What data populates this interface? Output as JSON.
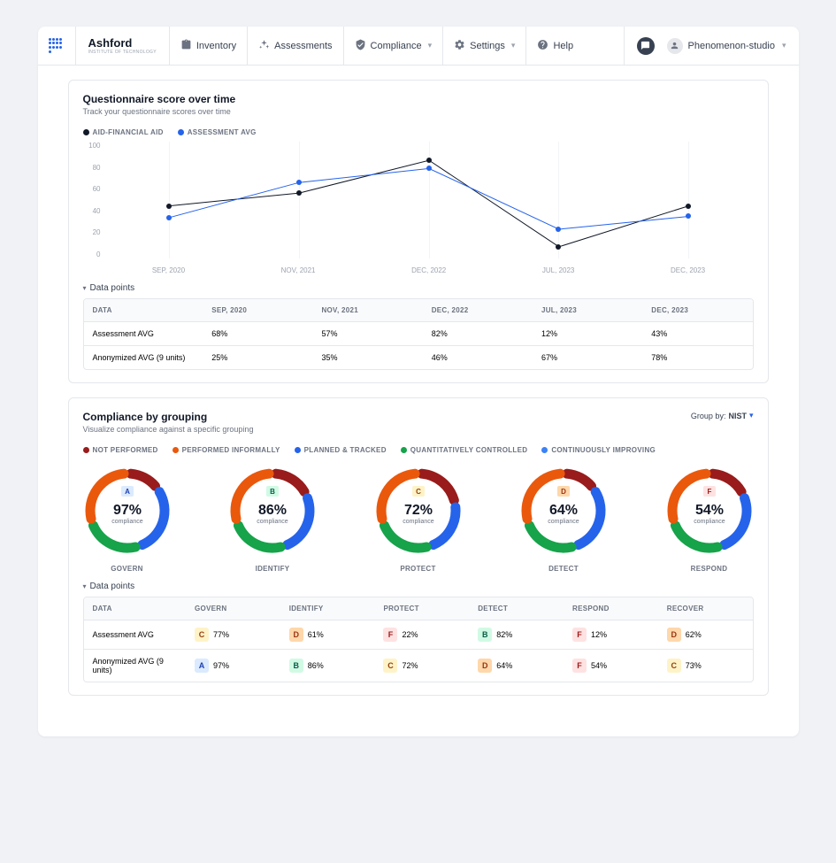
{
  "brand": "Ashford",
  "brand_sub": "INSTITUTE OF TECHNOLOGY",
  "nav": [
    {
      "label": "Inventory",
      "icon": "clipboard",
      "dropdown": false
    },
    {
      "label": "Assessments",
      "icon": "sparkle",
      "dropdown": false
    },
    {
      "label": "Compliance",
      "icon": "shield",
      "dropdown": true
    },
    {
      "label": "Settings",
      "icon": "gear",
      "dropdown": true
    },
    {
      "label": "Help",
      "icon": "question",
      "dropdown": false
    }
  ],
  "user": {
    "name": "Phenomenon-studio"
  },
  "card1": {
    "title": "Questionnaire score over time",
    "sub": "Track your questionnaire scores over time",
    "legend": [
      {
        "label": "AID-FINANCIAL AID",
        "color": "#111827"
      },
      {
        "label": "ASSESSMENT AVG",
        "color": "#2563eb"
      }
    ],
    "y_ticks": [
      "100",
      "80",
      "60",
      "40",
      "20",
      "0"
    ],
    "x_labels": [
      "SEP, 2020",
      "NOV, 2021",
      "DEC, 2022",
      "JUL, 2023",
      "DEC, 2023"
    ],
    "dp_label": "Data points",
    "table": {
      "headers": [
        "DATA",
        "SEP, 2020",
        "NOV, 2021",
        "DEC, 2022",
        "JUL, 2023",
        "DEC, 2023"
      ],
      "rows": [
        [
          "Assessment AVG",
          "68%",
          "57%",
          "82%",
          "12%",
          "43%"
        ],
        [
          "Anonymized AVG (9 units)",
          "25%",
          "35%",
          "46%",
          "67%",
          "78%"
        ]
      ]
    }
  },
  "card2": {
    "title": "Compliance by grouping",
    "sub": "Visualize compliance against a specific grouping",
    "group_by_label": "Group by:",
    "group_by_value": "NIST",
    "legend": [
      {
        "label": "NOT PERFORMED",
        "color": "#991b1b"
      },
      {
        "label": "PERFORMED INFORMALLY",
        "color": "#ea580c"
      },
      {
        "label": "PLANNED & TRACKED",
        "color": "#2563eb"
      },
      {
        "label": "QUANTITATIVELY CONTROLLED",
        "color": "#16a34a"
      },
      {
        "label": "CONTINUOUSLY IMPROVING",
        "color": "#3b82f6"
      }
    ],
    "donuts": [
      {
        "label": "GOVERN",
        "pct": "97%",
        "grade": "A",
        "segments": [
          {
            "c": "#991b1b",
            "p": 15
          },
          {
            "c": "#2563eb",
            "p": 30
          },
          {
            "c": "#16a34a",
            "p": 25
          },
          {
            "c": "#ea580c",
            "p": 30
          }
        ]
      },
      {
        "label": "IDENTIFY",
        "pct": "86%",
        "grade": "B",
        "segments": [
          {
            "c": "#991b1b",
            "p": 18
          },
          {
            "c": "#2563eb",
            "p": 27
          },
          {
            "c": "#16a34a",
            "p": 25
          },
          {
            "c": "#ea580c",
            "p": 30
          }
        ]
      },
      {
        "label": "PROTECT",
        "pct": "72%",
        "grade": "C",
        "segments": [
          {
            "c": "#991b1b",
            "p": 22
          },
          {
            "c": "#2563eb",
            "p": 23
          },
          {
            "c": "#16a34a",
            "p": 25
          },
          {
            "c": "#ea580c",
            "p": 30
          }
        ]
      },
      {
        "label": "DETECT",
        "pct": "64%",
        "grade": "D",
        "segments": [
          {
            "c": "#991b1b",
            "p": 15
          },
          {
            "c": "#2563eb",
            "p": 30
          },
          {
            "c": "#16a34a",
            "p": 25
          },
          {
            "c": "#ea580c",
            "p": 30
          }
        ]
      },
      {
        "label": "RESPOND",
        "pct": "54%",
        "grade": "F",
        "segments": [
          {
            "c": "#991b1b",
            "p": 18
          },
          {
            "c": "#2563eb",
            "p": 27
          },
          {
            "c": "#16a34a",
            "p": 25
          },
          {
            "c": "#ea580c",
            "p": 30
          }
        ]
      }
    ],
    "compliance_label": "compliance",
    "dp_label": "Data points",
    "table": {
      "headers": [
        "DATA",
        "GOVERN",
        "IDENTIFY",
        "PROTECT",
        "DETECT",
        "RESPOND",
        "RECOVER"
      ],
      "rows": [
        {
          "label": "Assessment AVG",
          "cells": [
            {
              "g": "C",
              "v": "77%"
            },
            {
              "g": "D",
              "v": "61%"
            },
            {
              "g": "F",
              "v": "22%"
            },
            {
              "g": "B",
              "v": "82%"
            },
            {
              "g": "F",
              "v": "12%"
            },
            {
              "g": "D",
              "v": "62%"
            }
          ]
        },
        {
          "label": "Anonymized AVG (9 units)",
          "cells": [
            {
              "g": "A",
              "v": "97%"
            },
            {
              "g": "B",
              "v": "86%"
            },
            {
              "g": "C",
              "v": "72%"
            },
            {
              "g": "D",
              "v": "64%"
            },
            {
              "g": "F",
              "v": "54%"
            },
            {
              "g": "C",
              "v": "73%"
            }
          ]
        }
      ]
    }
  },
  "chart_data": {
    "type": "line",
    "xlabel": "",
    "ylabel": "",
    "ylim": [
      0,
      100
    ],
    "categories": [
      "SEP, 2020",
      "NOV, 2021",
      "DEC, 2022",
      "JUL, 2023",
      "DEC, 2023"
    ],
    "series": [
      {
        "name": "AID-FINANCIAL AID",
        "color": "#111827",
        "values": [
          45,
          56,
          84,
          10,
          45
        ]
      },
      {
        "name": "ASSESSMENT AVG",
        "color": "#2563eb",
        "values": [
          35,
          65,
          77,
          25,
          36
        ]
      }
    ]
  }
}
